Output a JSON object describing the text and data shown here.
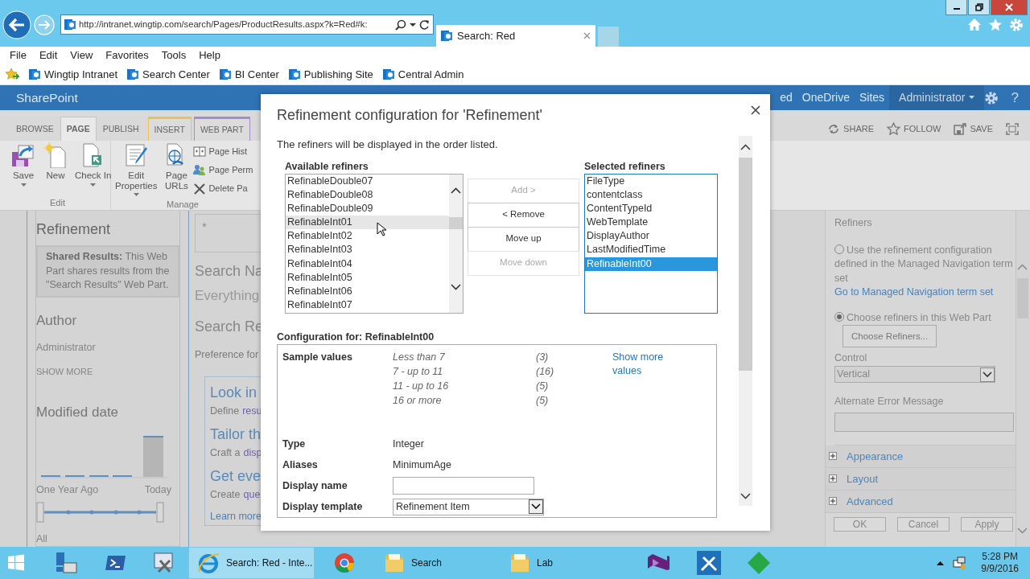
{
  "browser": {
    "address": "http://intranet.wingtip.com/search/Pages/ProductResults.aspx?k=Red#k:",
    "tabs": [
      {
        "title": "Search: Red",
        "selected": true
      }
    ],
    "menu": [
      "File",
      "Edit",
      "View",
      "Favorites",
      "Tools",
      "Help"
    ],
    "favorites": [
      "Wingtip Intranet",
      "Search Center",
      "BI Center",
      "Publishing Site",
      "Central Admin"
    ]
  },
  "suite_bar": {
    "brand": "SharePoint",
    "links": [
      "ed",
      "OneDrive",
      "Sites"
    ],
    "user": "Administrator",
    "help": "?"
  },
  "ribbon": {
    "tabs": [
      {
        "label": "BROWSE",
        "selected": false
      },
      {
        "label": "PAGE",
        "selected": true
      },
      {
        "label": "PUBLISH",
        "selected": false
      },
      {
        "label": "INSERT",
        "selected": false,
        "color": "#e3c35a"
      },
      {
        "label": "WEB PART",
        "selected": false,
        "color": "#a68bcf"
      }
    ],
    "actions": [
      "SHARE",
      "FOLLOW",
      "SAVE"
    ],
    "groups": [
      {
        "label": "Edit",
        "large": [
          {
            "label": "Save",
            "dropdown": true
          },
          {
            "label": "New",
            "dropdown": false
          },
          {
            "label": "Check In",
            "dropdown": true
          }
        ]
      },
      {
        "label": "Manage",
        "large": [
          {
            "label": "Edit Properties",
            "dropdown": true
          },
          {
            "label": "Page URLs",
            "dropdown": false
          }
        ],
        "small": [
          "Page Hist",
          "Page Perm",
          "Delete Pa"
        ]
      }
    ]
  },
  "left_zone": {
    "title": "Refinement",
    "notice": "**Shared Results:** This Web Part shares results from the \"Search Results\" Web Part.",
    "author": {
      "title": "Author",
      "values": [
        "Administrator"
      ],
      "more": "SHOW MORE"
    },
    "modified": {
      "title": "Modified date",
      "start": "One Year Ago",
      "end": "Today",
      "handles": [
        {
          "level": 0
        },
        {
          "level": 1
        }
      ],
      "selection": "All"
    }
  },
  "middle_zone": {
    "query": "*",
    "navigation_title": "Search Na",
    "navigation_item": "Everything",
    "results_title": "Search Re",
    "preference": "Preference for",
    "tips": [
      {
        "heading": "Look in",
        "text": "Define",
        "link": "resu"
      },
      {
        "heading": "Tailor th",
        "text": "Craft a",
        "link": "disp"
      },
      {
        "heading": "Get eve",
        "text": "Create",
        "link": "que"
      }
    ],
    "more": "Learn more"
  },
  "dialog": {
    "title": "Refinement configuration for 'Refinement'",
    "intro": "The refiners will be displayed in the order listed.",
    "available": {
      "label": "Available refiners",
      "items": [
        {
          "label": "RefinableDouble07",
          "hovered": false
        },
        {
          "label": "RefinableDouble08",
          "hovered": false
        },
        {
          "label": "RefinableDouble09",
          "hovered": false
        },
        {
          "label": "RefinableInt01",
          "hovered": true
        },
        {
          "label": "RefinableInt02",
          "hovered": false
        },
        {
          "label": "RefinableInt03",
          "hovered": false
        },
        {
          "label": "RefinableInt04",
          "hovered": false
        },
        {
          "label": "RefinableInt05",
          "hovered": false
        },
        {
          "label": "RefinableInt06",
          "hovered": false
        },
        {
          "label": "RefinableInt07",
          "hovered": false
        }
      ]
    },
    "buttons": [
      {
        "label": "Add >",
        "disabled": true
      },
      {
        "label": "< Remove",
        "disabled": false
      },
      {
        "label": "Move up",
        "disabled": false
      },
      {
        "label": "Move down",
        "disabled": true
      }
    ],
    "selected": {
      "label": "Selected refiners",
      "items": [
        {
          "label": "FileType",
          "selected": false
        },
        {
          "label": "contentclass",
          "selected": false
        },
        {
          "label": "ContentTypeId",
          "selected": false
        },
        {
          "label": "WebTemplate",
          "selected": false
        },
        {
          "label": "DisplayAuthor",
          "selected": false
        },
        {
          "label": "LastModifiedTime",
          "selected": false
        },
        {
          "label": "RefinableInt00",
          "selected": true
        }
      ]
    },
    "configuration": {
      "heading": "Configuration for: RefinableInt00",
      "samples_label": "Sample values",
      "samples": [
        {
          "value": "Less than 7",
          "count": "(3)"
        },
        {
          "value": "7 - up to 11",
          "count": "(16)"
        },
        {
          "value": "11 - up to 16",
          "count": "(5)"
        },
        {
          "value": "16 or more",
          "count": "(5)"
        }
      ],
      "more": "Show more values",
      "fields": [
        {
          "label": "Type",
          "kind": "text",
          "value": "Integer"
        },
        {
          "label": "Aliases",
          "kind": "text",
          "value": "MinimumAge"
        },
        {
          "label": "Display name",
          "kind": "input"
        },
        {
          "label": "Display template",
          "kind": "select",
          "value": "Refinement Item"
        }
      ]
    }
  },
  "tool_pane": {
    "heading": "Refiners",
    "options": [
      {
        "label": "Use the refinement configuration defined in the Managed Navigation term set",
        "selected": false,
        "link": "Go to Managed Navigation term set"
      },
      {
        "label": "Choose refiners in this Web Part",
        "selected": true,
        "button": "Choose Refiners..."
      }
    ],
    "control_label": "Control",
    "control_value": "Vertical",
    "error_label": "Alternate Error Message",
    "sections": [
      {
        "label": "Appearance",
        "expanded": false
      },
      {
        "label": "Layout",
        "expanded": false
      },
      {
        "label": "Advanced",
        "expanded": false
      }
    ],
    "buttons": [
      "OK",
      "Cancel",
      "Apply"
    ]
  },
  "taskbar": {
    "items": [
      {
        "selected": false
      },
      {
        "selected": false
      },
      {
        "selected": false
      },
      {
        "selected": false
      },
      {
        "label": "Search: Red - Inte...",
        "selected": true
      },
      {
        "selected": false
      },
      {
        "label": "Search",
        "selected": false
      },
      {
        "label": "Lab",
        "selected": false
      },
      {
        "selected": false
      },
      {
        "selected": false
      },
      {
        "selected": false
      }
    ],
    "time": "5:28 PM",
    "date": "9/9/2016"
  }
}
